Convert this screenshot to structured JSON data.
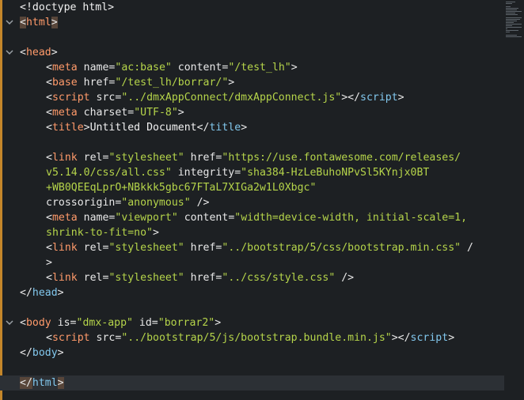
{
  "editor": {
    "accent_color": "#c4862a",
    "lines": [
      {
        "fold": "",
        "tokens": [
          {
            "t": "<!doctype html>",
            "c": "doctype"
          }
        ]
      },
      {
        "fold": "v",
        "tokens": [
          {
            "t": "<",
            "c": "brk",
            "hl": true
          },
          {
            "t": "html",
            "c": "tag"
          },
          {
            "t": ">",
            "c": "brk",
            "hl": true
          }
        ]
      },
      {
        "fold": "",
        "tokens": []
      },
      {
        "fold": "v",
        "tokens": [
          {
            "t": "<",
            "c": "brk"
          },
          {
            "t": "head",
            "c": "tag"
          },
          {
            "t": ">",
            "c": "brk"
          }
        ]
      },
      {
        "fold": "",
        "indent": 1,
        "tokens": [
          {
            "t": "<",
            "c": "brk"
          },
          {
            "t": "meta",
            "c": "tag"
          },
          {
            "t": " name",
            "c": "attr"
          },
          {
            "t": "=",
            "c": "eq"
          },
          {
            "t": "\"ac:base\"",
            "c": "str"
          },
          {
            "t": " content",
            "c": "attr"
          },
          {
            "t": "=",
            "c": "eq"
          },
          {
            "t": "\"/test_lh\"",
            "c": "str"
          },
          {
            "t": ">",
            "c": "brk"
          }
        ]
      },
      {
        "fold": "",
        "indent": 1,
        "tokens": [
          {
            "t": "<",
            "c": "brk"
          },
          {
            "t": "base",
            "c": "tag"
          },
          {
            "t": " href",
            "c": "attr"
          },
          {
            "t": "=",
            "c": "eq"
          },
          {
            "t": "\"/test_lh/borrar/\"",
            "c": "str"
          },
          {
            "t": ">",
            "c": "brk"
          }
        ]
      },
      {
        "fold": "",
        "indent": 1,
        "tokens": [
          {
            "t": "<",
            "c": "brk"
          },
          {
            "t": "script",
            "c": "tag"
          },
          {
            "t": " src",
            "c": "attr"
          },
          {
            "t": "=",
            "c": "eq"
          },
          {
            "t": "\"../dmxAppConnect/dmxAppConnect.js\"",
            "c": "str"
          },
          {
            "t": "></",
            "c": "brk"
          },
          {
            "t": "script",
            "c": "close"
          },
          {
            "t": ">",
            "c": "brk"
          }
        ]
      },
      {
        "fold": "",
        "indent": 1,
        "tokens": [
          {
            "t": "<",
            "c": "brk"
          },
          {
            "t": "meta",
            "c": "tag"
          },
          {
            "t": " charset",
            "c": "attr"
          },
          {
            "t": "=",
            "c": "eq"
          },
          {
            "t": "\"UTF-8\"",
            "c": "str"
          },
          {
            "t": ">",
            "c": "brk"
          }
        ]
      },
      {
        "fold": "",
        "indent": 1,
        "tokens": [
          {
            "t": "<",
            "c": "brk"
          },
          {
            "t": "title",
            "c": "tag"
          },
          {
            "t": ">",
            "c": "brk"
          },
          {
            "t": "Untitled Document",
            "c": "text"
          },
          {
            "t": "</",
            "c": "brk"
          },
          {
            "t": "title",
            "c": "close"
          },
          {
            "t": ">",
            "c": "brk"
          }
        ]
      },
      {
        "fold": "",
        "tokens": []
      },
      {
        "fold": "",
        "indent": 1,
        "tokens": [
          {
            "t": "<",
            "c": "brk"
          },
          {
            "t": "link",
            "c": "tag"
          },
          {
            "t": " rel",
            "c": "attr"
          },
          {
            "t": "=",
            "c": "eq"
          },
          {
            "t": "\"stylesheet\"",
            "c": "str"
          },
          {
            "t": " href",
            "c": "attr"
          },
          {
            "t": "=",
            "c": "eq"
          },
          {
            "t": "\"https://use.fontawesome.com/releases/",
            "c": "str"
          }
        ]
      },
      {
        "fold": "",
        "indent": 1,
        "tokens": [
          {
            "t": "v5.14.0/css/all.css\"",
            "c": "str"
          },
          {
            "t": " integrity",
            "c": "attr"
          },
          {
            "t": "=",
            "c": "eq"
          },
          {
            "t": "\"sha384-HzLeBuhoNPvSl5KYnjx0BT",
            "c": "str"
          }
        ]
      },
      {
        "fold": "",
        "indent": 1,
        "tokens": [
          {
            "t": "+WB0QEEqLprO+NBkkk5gbc67FTaL7XIGa2w1L0Xbgc\"",
            "c": "str"
          }
        ]
      },
      {
        "fold": "",
        "indent": 1,
        "tokens": [
          {
            "t": "crossorigin",
            "c": "attr"
          },
          {
            "t": "=",
            "c": "eq"
          },
          {
            "t": "\"anonymous\"",
            "c": "str"
          },
          {
            "t": " />",
            "c": "brk"
          }
        ]
      },
      {
        "fold": "",
        "indent": 1,
        "tokens": [
          {
            "t": "<",
            "c": "brk"
          },
          {
            "t": "meta",
            "c": "tag"
          },
          {
            "t": " name",
            "c": "attr"
          },
          {
            "t": "=",
            "c": "eq"
          },
          {
            "t": "\"viewport\"",
            "c": "str"
          },
          {
            "t": " content",
            "c": "attr"
          },
          {
            "t": "=",
            "c": "eq"
          },
          {
            "t": "\"width=device-width, initial-scale=1,",
            "c": "str"
          }
        ]
      },
      {
        "fold": "",
        "indent": 1,
        "tokens": [
          {
            "t": "shrink-to-fit=no\"",
            "c": "str"
          },
          {
            "t": ">",
            "c": "brk"
          }
        ]
      },
      {
        "fold": "",
        "indent": 1,
        "tokens": [
          {
            "t": "<",
            "c": "brk"
          },
          {
            "t": "link",
            "c": "tag"
          },
          {
            "t": " rel",
            "c": "attr"
          },
          {
            "t": "=",
            "c": "eq"
          },
          {
            "t": "\"stylesheet\"",
            "c": "str"
          },
          {
            "t": " href",
            "c": "attr"
          },
          {
            "t": "=",
            "c": "eq"
          },
          {
            "t": "\"../bootstrap/5/css/bootstrap.min.css\"",
            "c": "str"
          },
          {
            "t": " /",
            "c": "brk"
          }
        ]
      },
      {
        "fold": "",
        "indent": 1,
        "tokens": [
          {
            "t": ">",
            "c": "brk"
          }
        ]
      },
      {
        "fold": "",
        "indent": 1,
        "tokens": [
          {
            "t": "<",
            "c": "brk"
          },
          {
            "t": "link",
            "c": "tag"
          },
          {
            "t": " rel",
            "c": "attr"
          },
          {
            "t": "=",
            "c": "eq"
          },
          {
            "t": "\"stylesheet\"",
            "c": "str"
          },
          {
            "t": " href",
            "c": "attr"
          },
          {
            "t": "=",
            "c": "eq"
          },
          {
            "t": "\"../css/style.css\"",
            "c": "str"
          },
          {
            "t": " />",
            "c": "brk"
          }
        ]
      },
      {
        "fold": "",
        "tokens": [
          {
            "t": "</",
            "c": "brk"
          },
          {
            "t": "head",
            "c": "close"
          },
          {
            "t": ">",
            "c": "brk"
          }
        ]
      },
      {
        "fold": "",
        "tokens": []
      },
      {
        "fold": "v",
        "tokens": [
          {
            "t": "<",
            "c": "brk"
          },
          {
            "t": "body",
            "c": "tag"
          },
          {
            "t": " is",
            "c": "attr"
          },
          {
            "t": "=",
            "c": "eq"
          },
          {
            "t": "\"dmx-app\"",
            "c": "str"
          },
          {
            "t": " id",
            "c": "attr"
          },
          {
            "t": "=",
            "c": "eq"
          },
          {
            "t": "\"borrar2\"",
            "c": "str"
          },
          {
            "t": ">",
            "c": "brk"
          }
        ]
      },
      {
        "fold": "",
        "indent": 1,
        "tokens": [
          {
            "t": "<",
            "c": "brk"
          },
          {
            "t": "script",
            "c": "tag"
          },
          {
            "t": " src",
            "c": "attr"
          },
          {
            "t": "=",
            "c": "eq"
          },
          {
            "t": "\"../bootstrap/5/js/bootstrap.bundle.min.js\"",
            "c": "str"
          },
          {
            "t": "></",
            "c": "brk"
          },
          {
            "t": "script",
            "c": "close"
          },
          {
            "t": ">",
            "c": "brk"
          }
        ]
      },
      {
        "fold": "",
        "tokens": [
          {
            "t": "</",
            "c": "brk"
          },
          {
            "t": "body",
            "c": "close"
          },
          {
            "t": ">",
            "c": "brk"
          }
        ]
      },
      {
        "fold": "",
        "tokens": []
      },
      {
        "fold": "",
        "active": true,
        "tokens": [
          {
            "t": "</",
            "c": "brk",
            "hl": true
          },
          {
            "t": "html",
            "c": "close"
          },
          {
            "t": ">",
            "c": "brk",
            "hl": true
          }
        ]
      }
    ]
  }
}
